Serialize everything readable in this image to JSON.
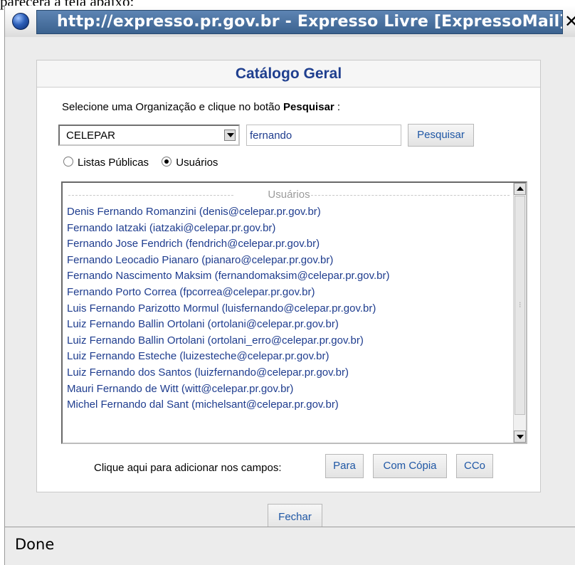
{
  "background_text": "parecerá a tela abaixo:",
  "window": {
    "title": "http://expresso.pr.gov.br - Expresso Livre [ExpressoMail] - ",
    "close_glyph": "✕"
  },
  "catalog": {
    "title": "Catálogo Geral",
    "instruction_prefix": "Selecione uma Organização e clique no botão ",
    "instruction_bold": "Pesquisar",
    "instruction_suffix": " :",
    "organization": "CELEPAR",
    "search_value": "fernando",
    "search_button": "Pesquisar",
    "radio_public_lists": "Listas Públicas",
    "radio_users": "Usuários",
    "selected_radio": "Usuários",
    "results_legend": "Usuários",
    "users": [
      "Denis Fernando Romanzini (denis@celepar.pr.gov.br)",
      "Fernando Iatzaki (iatzaki@celepar.pr.gov.br)",
      "Fernando Jose Fendrich (fendrich@celepar.pr.gov.br)",
      "Fernando Leocadio Pianaro (pianaro@celepar.pr.gov.br)",
      "Fernando Nascimento Maksim (fernandomaksim@celepar.pr.gov.br)",
      "Fernando Porto Correa (fpcorrea@celepar.pr.gov.br)",
      "Luis Fernando Parizotto Mormul (luisfernando@celepar.pr.gov.br)",
      "Luiz Fernando Ballin Ortolani (ortolani@celepar.pr.gov.br)",
      "Luiz Fernando Ballin Ortolani (ortolani_erro@celepar.pr.gov.br)",
      "Luiz Fernando Esteche (luizesteche@celepar.pr.gov.br)",
      "Luiz Fernando dos Santos (luizfernando@celepar.pr.gov.br)",
      "Mauri Fernando de Witt (witt@celepar.pr.gov.br)",
      "Michel Fernando dal Sant (michelsant@celepar.pr.gov.br)"
    ],
    "add_fields_label": "Clique aqui para adicionar nos campos:",
    "btn_para": "Para",
    "btn_com_copia": "Com Cópia",
    "btn_cco": "CCo"
  },
  "close_button": "Fechar",
  "status": "Done",
  "colors": {
    "title_bar": "#4a6f9d",
    "link_blue": "#1e3c8e",
    "catalog_title": "#1f3f8f"
  }
}
